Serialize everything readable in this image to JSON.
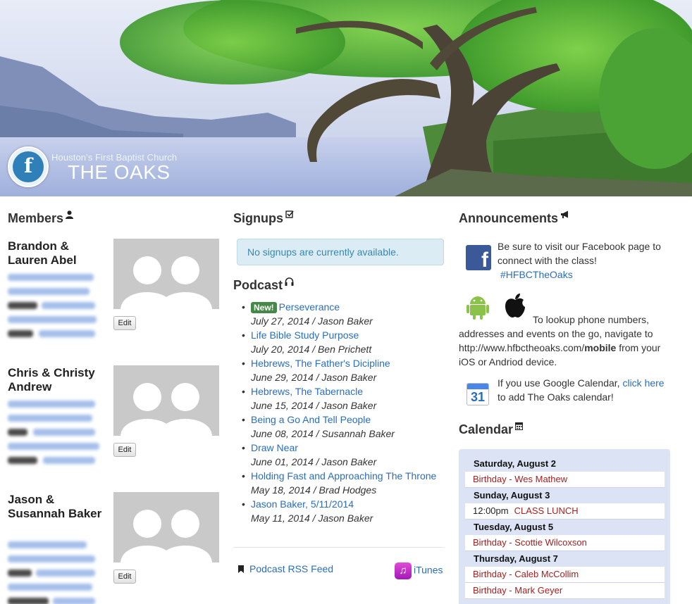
{
  "header": {
    "church_name": "Houston's First Baptist Church",
    "class_name": "THE OAKS",
    "logo_glyph": "f",
    "colors": {
      "sky": "#c9d3ea",
      "lake": "#b9c4e2",
      "foliage": "#5db83a",
      "trunk": "#4a4336"
    }
  },
  "members": {
    "title": "Members",
    "title_icon": "user-icon",
    "edit_label": "Edit",
    "items": [
      {
        "name": "Brandon & Lauren Abel"
      },
      {
        "name": "Chris & Christy Andrew"
      },
      {
        "name": "Jason & Susannah Baker"
      }
    ]
  },
  "signups": {
    "title": "Signups",
    "title_icon": "check-square-icon",
    "empty_message": "No signups are currently available."
  },
  "podcast": {
    "title": "Podcast",
    "title_icon": "headphones-icon",
    "new_badge": "New!",
    "items": [
      {
        "title": "Perseverance",
        "meta": "July 27, 2014 / Jason Baker",
        "is_new": true
      },
      {
        "title": "Life Bible Study Purpose",
        "meta": "July 20, 2014 / Ben Prichett"
      },
      {
        "title": "Hebrews, The Father's Dicipline",
        "meta": "June 29, 2014 / Jason Baker"
      },
      {
        "title": "Hebrews, The Tabernacle",
        "meta": "June 15, 2014 / Jason Baker"
      },
      {
        "title": "Being a Go And Tell People",
        "meta": "June 08, 2014 / Susannah Baker"
      },
      {
        "title": "Draw Near",
        "meta": "June 01, 2014 / Jason Baker"
      },
      {
        "title": "Holding Fast and Approaching The Throne",
        "meta": "May 18, 2014 / Brad Hodges"
      },
      {
        "title": "Jason Baker, 5/11/2014",
        "meta": "May 11, 2014 / Jason Baker"
      }
    ],
    "rss_label": "Podcast RSS Feed",
    "itunes_label": "iTunes"
  },
  "announcements": {
    "title": "Announcements",
    "title_icon": "bullhorn-icon",
    "facebook_text": "Be sure to visit our Facebook page to connect with the class!",
    "facebook_tag": "#HFBCTheOaks",
    "mobile_text_before": "To lookup phone numbers, addresses and events on the go, navigate to http://www.hfbctheoaks.com/",
    "mobile_bold": "mobile",
    "mobile_text_after": " from your iOS or Andriod device.",
    "google_text_before": "If you use Google Calendar, ",
    "google_link": "click here",
    "google_text_after": "to add The Oaks calendar!",
    "calendar_icon_day": "31"
  },
  "calendar": {
    "title": "Calendar",
    "title_icon": "calendar-icon",
    "days": [
      {
        "label": "Saturday, August 2",
        "events": [
          {
            "time": "",
            "title": "Birthday - Wes Mathew"
          }
        ]
      },
      {
        "label": "Sunday, August 3",
        "events": [
          {
            "time": "12:00pm",
            "title": "CLASS LUNCH"
          }
        ]
      },
      {
        "label": "Tuesday, August 5",
        "events": [
          {
            "time": "",
            "title": "Birthday - Scottie Wilcoxson"
          }
        ]
      },
      {
        "label": "Thursday, August 7",
        "events": [
          {
            "time": "",
            "title": "Birthday - Caleb McCollim"
          },
          {
            "time": "",
            "title": "Birthday - Mark Geyer"
          }
        ]
      }
    ]
  }
}
